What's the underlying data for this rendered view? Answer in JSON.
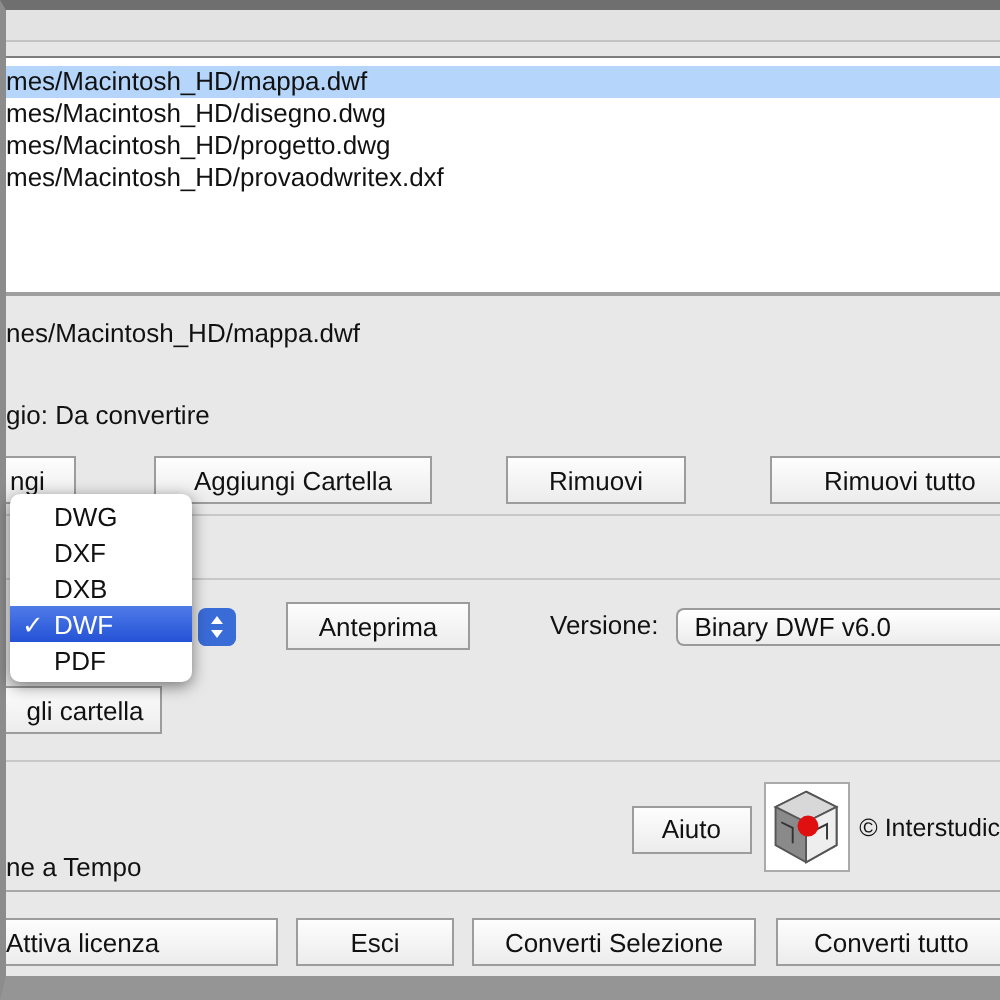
{
  "file_list": {
    "rows": [
      {
        "path": "mes/Macintosh_HD/mappa.dwf",
        "selected": true
      },
      {
        "path": "mes/Macintosh_HD/disegno.dwg",
        "selected": false
      },
      {
        "path": "mes/Macintosh_HD/progetto.dwg",
        "selected": false
      },
      {
        "path": "mes/Macintosh_HD/provaodwritex.dxf",
        "selected": false
      }
    ]
  },
  "selected_path": "nes/Macintosh_HD/mappa.dwf",
  "status": "gio: Da convertire",
  "file_buttons": [
    "ngi",
    "Aggiungi Cartella",
    "Rimuovi",
    "Rimuovi tutto"
  ],
  "format_menu": [
    {
      "label": "DWG",
      "selected": false
    },
    {
      "label": "DXF",
      "selected": false
    },
    {
      "label": "DXB",
      "selected": false
    },
    {
      "label": "DWF",
      "selected": true,
      "check": "✓"
    },
    {
      "label": "PDF",
      "selected": false
    }
  ],
  "preview_button": "Anteprima",
  "version": {
    "label": "Versione:",
    "value": "Binary DWF v6.0"
  },
  "folder_button": "gli cartella",
  "help_button": "Aiuto",
  "copyright": "© Interstudic",
  "timing_label": "ne a Tempo",
  "actions": [
    "Attiva licenza",
    "Esci",
    "Converti Selezione",
    "Converti tutto"
  ]
}
